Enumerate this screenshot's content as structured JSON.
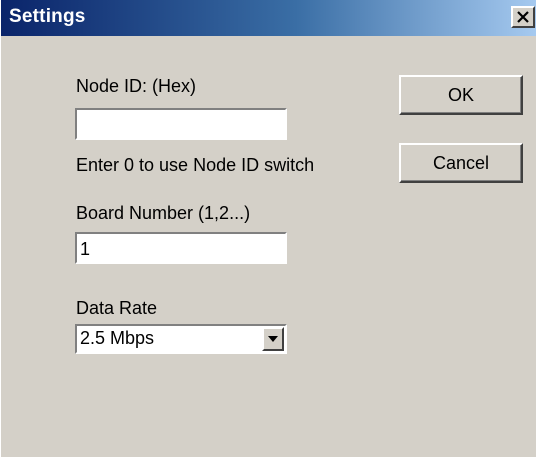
{
  "window": {
    "title": "Settings",
    "close_label": "×"
  },
  "form": {
    "node_id": {
      "label": "Node ID: (Hex)",
      "value": "",
      "hint": "Enter 0 to use Node ID switch"
    },
    "board_number": {
      "label": "Board Number (1,2...)",
      "value": "1"
    },
    "data_rate": {
      "label": "Data Rate",
      "selected": "2.5 Mbps"
    }
  },
  "buttons": {
    "ok_label": "OK",
    "cancel_label": "Cancel"
  },
  "colors": {
    "title_bar_start": "#0a246a",
    "title_bar_end": "#a6caf0",
    "dialog_face": "#d4d0c8"
  }
}
